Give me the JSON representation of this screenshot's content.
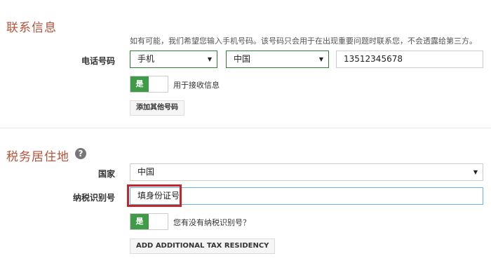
{
  "contact": {
    "title": "联系信息",
    "note": "如有可能，我们希望您输入手机号码。该号码只会用于在出现重要问题时联系您，不会透露给第三方。",
    "phone_label": "电话号码",
    "phone_type": "手机",
    "country": "中国",
    "phone_number": "13512345678",
    "toggle_on": "是",
    "toggle_label": "用于接收信息",
    "add_phone_button": "添加其他号码"
  },
  "tax": {
    "title": "税务居住地",
    "help_icon": "?",
    "country_label": "国家",
    "country": "中国",
    "tin_label": "纳税识别号",
    "tin_value": "填身份证号",
    "toggle_on": "是",
    "toggle_label": "您有没有纳税识别号？",
    "add_residency_button": "ADD ADDITIONAL TAX RESIDENCY"
  },
  "colors": {
    "section_title": "#b5533a",
    "toggle_green": "#3f9b47",
    "select_border": "#2e7d32",
    "highlight": "#c0262c"
  }
}
